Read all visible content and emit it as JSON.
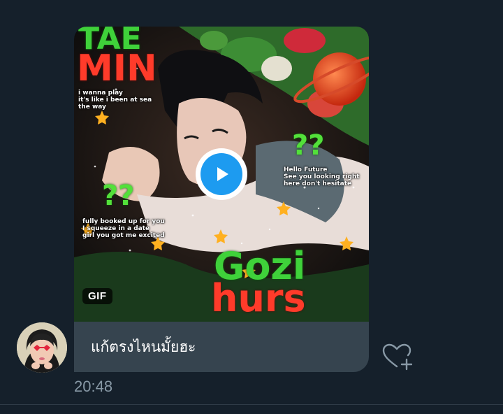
{
  "message": {
    "time": "20:48",
    "caption": "แก้ตรงไหนมั้ยฮะ",
    "media": {
      "type_badge": "GIF",
      "art_text": {
        "name_top_1": "TAE",
        "name_top_2": "MIN",
        "name_bottom_1": "Gozi",
        "name_bottom_2": "hurs",
        "question_marks": "??",
        "lyric_1": "i wanna play\nit's like i been at sea\nthe way",
        "lyric_2": "Hello Future\nSee you looking right\nhere don't hesitate",
        "lyric_3": "fully booked up for you\nI squeeze in a date\ngirl you got me excited"
      }
    }
  },
  "icons": {
    "play": "play-icon",
    "like": "heart-plus-icon"
  },
  "colors": {
    "background": "#15202b",
    "caption_bg": "#36444f",
    "play_blue": "#1d9bf0",
    "timestamp": "#8899a6"
  }
}
